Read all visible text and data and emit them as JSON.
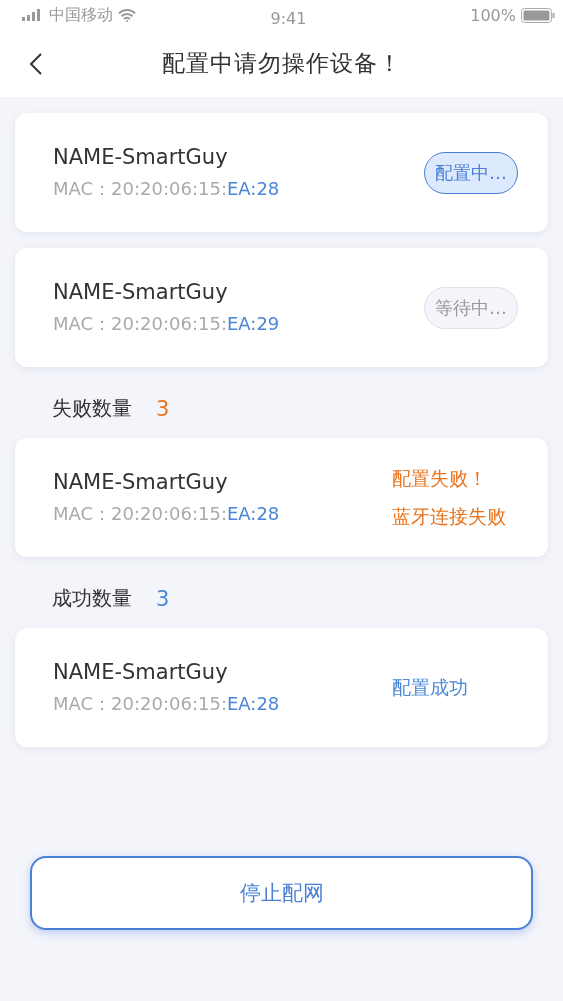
{
  "status_bar": {
    "carrier": "中国移动",
    "time": "9:41",
    "battery": "100%"
  },
  "nav": {
    "title": "配置中请勿操作设备！"
  },
  "sections": [
    {
      "devices": [
        {
          "name": "NAME-SmartGuy",
          "mac_label": "MAC：",
          "mac_prefix": "20:20:06:15:",
          "mac_suffix": "EA:28",
          "kind": "configuring",
          "messages": [
            "配置中…"
          ]
        },
        {
          "name": "NAME-SmartGuy",
          "mac_label": "MAC：",
          "mac_prefix": "20:20:06:15:",
          "mac_suffix": "EA:29",
          "kind": "waiting",
          "messages": [
            "等待中…"
          ]
        }
      ]
    },
    {
      "kind": "failed",
      "heading": "失败数量",
      "count": "3",
      "devices": [
        {
          "name": "NAME-SmartGuy",
          "mac_label": "MAC：",
          "mac_prefix": "20:20:06:15:",
          "mac_suffix": "EA:28",
          "kind": "failed",
          "messages": [
            "配置失败！",
            "蓝牙连接失败"
          ]
        }
      ]
    },
    {
      "kind": "success",
      "heading": "成功数量",
      "count": "3",
      "devices": [
        {
          "name": "NAME-SmartGuy",
          "mac_label": "MAC：",
          "mac_prefix": "20:20:06:15:",
          "mac_suffix": "EA:28",
          "kind": "success",
          "messages": [
            "配置成功"
          ]
        }
      ]
    }
  ],
  "stop_button": "停止配网"
}
